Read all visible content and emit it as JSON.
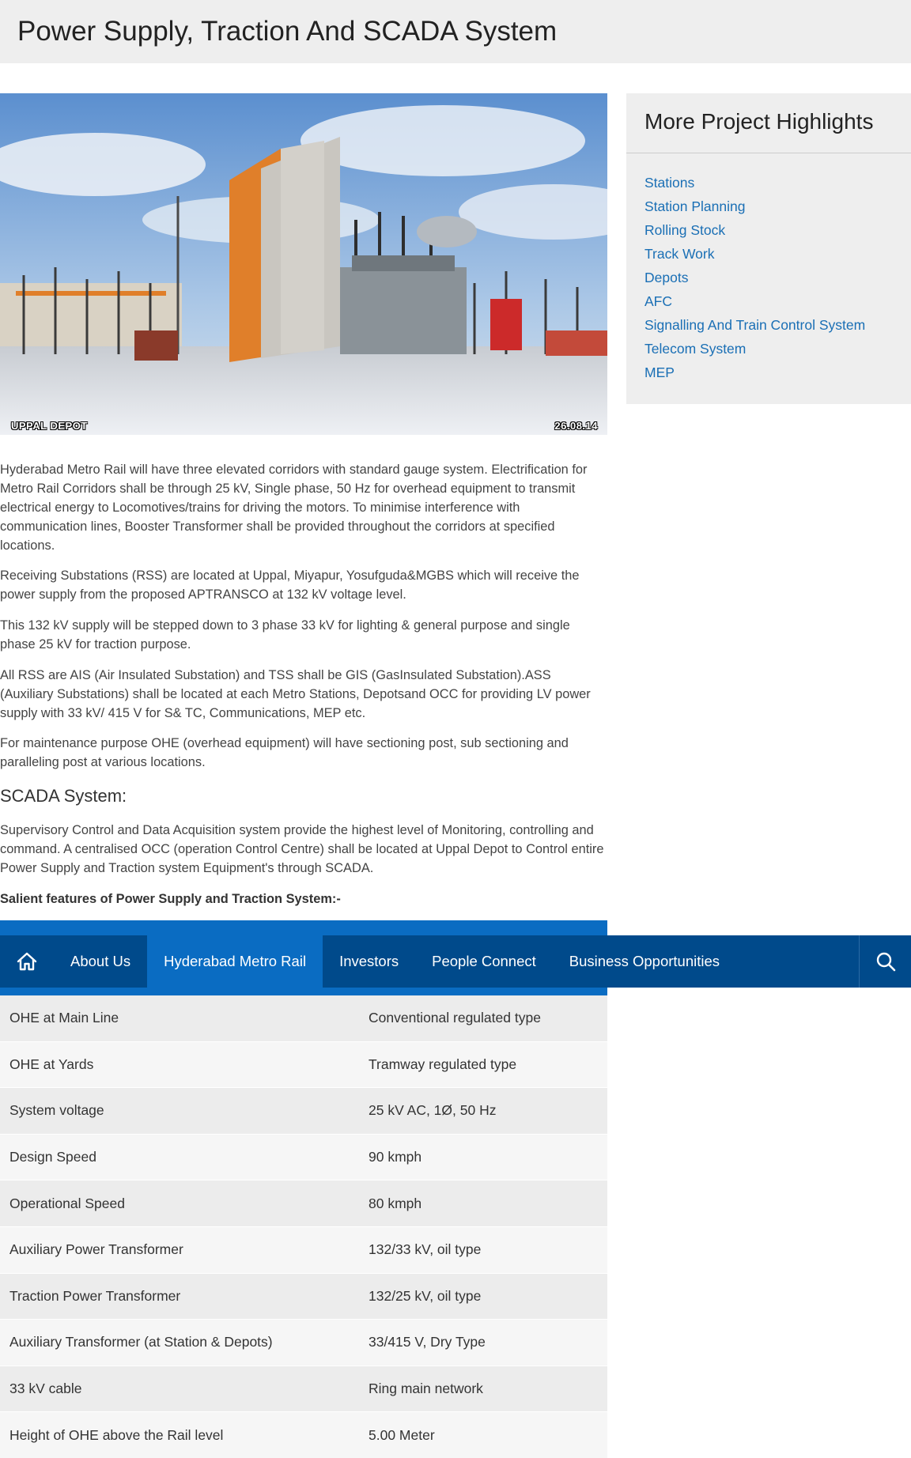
{
  "header": {
    "title": "Power Supply, Traction And SCADA System"
  },
  "hero": {
    "caption_left": "UPPAL DEPOT",
    "caption_right": "26.08.14"
  },
  "content": {
    "p1": "Hyderabad Metro Rail will have three elevated corridors with standard gauge system. Electrification for Metro Rail Corridors shall be through 25 kV, Single phase, 50 Hz for overhead equipment to transmit electrical energy to Locomotives/trains for driving the motors. To minimise interference with communication lines, Booster Transformer shall be provided throughout the corridors at specified locations.",
    "p2": "Receiving Substations (RSS) are located at Uppal, Miyapur, Yosufguda&MGBS which will receive the power supply from the proposed APTRANSCO at 132 kV voltage level.",
    "p3": "This 132 kV supply will be stepped down to 3 phase 33 kV for lighting & general purpose and single phase 25 kV for traction purpose.",
    "p4": "All RSS are AIS (Air Insulated Substation) and TSS shall be GIS (GasInsulated Substation).ASS (Auxiliary Substations) shall be located at each Metro Stations, Depotsand OCC for providing LV power supply with 33 kV/ 415 V for S& TC, Communications, MEP etc.",
    "p5": "For maintenance purpose OHE (overhead equipment) will have sectioning post, sub sectioning and paralleling post at various locations.",
    "scada_heading": "SCADA System:",
    "p6": "Supervisory Control and Data Acquisition system provide the highest level of Monitoring, controlling and command. A centralised OCC (operation Control Centre) shall be located at Uppal Depot to Control entire Power Supply and Traction system Equipment's through SCADA.",
    "salient_heading": "Salient features of Power Supply and Traction System:-"
  },
  "spec_table": [
    {
      "feature": "OHE at Main Line",
      "value": "Conventional regulated type"
    },
    {
      "feature": "OHE at Yards",
      "value": "Tramway regulated type"
    },
    {
      "feature": "System voltage",
      "value": "25 kV AC, 1Ø, 50 Hz"
    },
    {
      "feature": "Design Speed",
      "value": "90 kmph"
    },
    {
      "feature": "Operational Speed",
      "value": "80 kmph"
    },
    {
      "feature": "Auxiliary Power Transformer",
      "value": "132/33 kV, oil type"
    },
    {
      "feature": "Traction Power Transformer",
      "value": "132/25 kV, oil type"
    },
    {
      "feature": "Auxiliary Transformer (at Station & Depots)",
      "value": "33/415 V, Dry Type"
    },
    {
      "feature": "33 kV cable",
      "value": "Ring main network"
    },
    {
      "feature": "Height of OHE above the Rail level",
      "value": "5.00 Meter"
    }
  ],
  "sidebar": {
    "title": "More Project Highlights",
    "links": [
      "Stations",
      "Station Planning",
      "Rolling Stock",
      "Track Work",
      "Depots",
      "AFC",
      "Signalling And Train Control System",
      "Telecom System",
      "MEP"
    ]
  },
  "navbar": {
    "home_icon": "home-icon",
    "items": [
      {
        "label": "About Us",
        "active": false
      },
      {
        "label": "Hyderabad Metro Rail",
        "active": true
      },
      {
        "label": "Investors",
        "active": false
      },
      {
        "label": "People Connect",
        "active": false
      },
      {
        "label": "Business Opportunities",
        "active": false
      }
    ],
    "search_icon": "search-icon"
  },
  "colors": {
    "nav_bg": "#004a8b",
    "nav_active": "#0a6cc2",
    "link": "#1a6fb5",
    "panel_bg": "#eeeeee"
  }
}
